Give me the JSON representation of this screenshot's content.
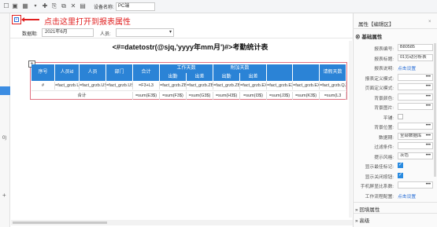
{
  "toolbar": {
    "icons": [
      "new-icon",
      "save-icon",
      "grid-icon",
      "undo-icon",
      "tool-icon",
      "copy-icon",
      "paste-icon",
      "delete-icon",
      "format-icon"
    ],
    "device_label": "设备名称:",
    "device_value": "PC端"
  },
  "annotation": {
    "note": "点击这里打开到报表属性"
  },
  "filter": {
    "period_label": "数据期:",
    "period_value": "2021年6月",
    "person_label": "人员:"
  },
  "left_panel": {
    "frag_text": "0)"
  },
  "report": {
    "title": "<#=datetostr(@sjq,'yyyy年mm月')#>考勤统计表",
    "headers": {
      "seq": "序号",
      "personid": "人员id",
      "person": "人员",
      "dept": "部门",
      "total": "合计",
      "workdays": "工作天数",
      "sub1a": "出勤",
      "sub1b": "出差",
      "overtime": "附加天数",
      "sub2a": "出勤",
      "sub2b": "出差",
      "leave": "请假天数"
    },
    "row1": [
      "#",
      "=fact_grzb.USERID",
      "=fact_grzb.USERID",
      "=fact_grzb.USRID",
      "=F3+L3",
      "=fact_grzb.ZBGS(F",
      "=fact_grzb.ZBGS(R",
      "=fact_grzb.ZBGS(R",
      "=fact_grzb.EXGS(R",
      "=fact_grzb.EXGS(R",
      "=fact_grzb.EXGS(R",
      "=fact_grzb.QJGS(R"
    ],
    "row2_label": "合计",
    "row2": [
      "=sum(E3$)",
      "=sum(F3$)",
      "=sum(G3$)",
      "=sum(H3$)",
      "=sum(I3$)",
      "=sum(J3$)",
      "=sum(K3$)",
      "=sum(L3"
    ]
  },
  "properties": {
    "title": "属性【编辑区】",
    "close": "×",
    "section_basic": "基础属性",
    "items": [
      {
        "label": "报表编号:",
        "value": "B80585",
        "type": "input"
      },
      {
        "label": "报表标题:",
        "value": "01劳动分析表",
        "type": "input"
      },
      {
        "label": "报表说明:",
        "value": "点击设置",
        "type": "link"
      },
      {
        "label": "报表定义模式:",
        "value": "",
        "type": "input"
      },
      {
        "label": "页面定义模式:",
        "value": "",
        "type": "input"
      },
      {
        "label": "背景颜色:",
        "value": "",
        "type": "input"
      },
      {
        "label": "背景图片:",
        "value": "",
        "type": "input"
      },
      {
        "label": "平铺:",
        "value": "",
        "type": "check"
      },
      {
        "label": "背景位置:",
        "value": "",
        "type": "input"
      },
      {
        "label": "数据期:",
        "value": "全部数据库",
        "type": "input"
      },
      {
        "label": "过滤条件:",
        "value": "",
        "type": "input"
      },
      {
        "label": "提示风格:",
        "value": "灰色",
        "type": "input"
      },
      {
        "label": "显示最佳标记:",
        "value": "",
        "type": "checkon"
      },
      {
        "label": "显示关闭按钮:",
        "value": "",
        "type": "checkon"
      },
      {
        "label": "手机屏显比系数:",
        "value": "",
        "type": "input"
      },
      {
        "label": "工作流程配置:",
        "value": "点击设置",
        "type": "link"
      }
    ],
    "section_macro": "回填属性",
    "section_adv": "高级"
  },
  "colors": {
    "header_blue": "#2b83d6",
    "annotation_red": "#e02020",
    "link_blue": "#2a6fd6"
  }
}
